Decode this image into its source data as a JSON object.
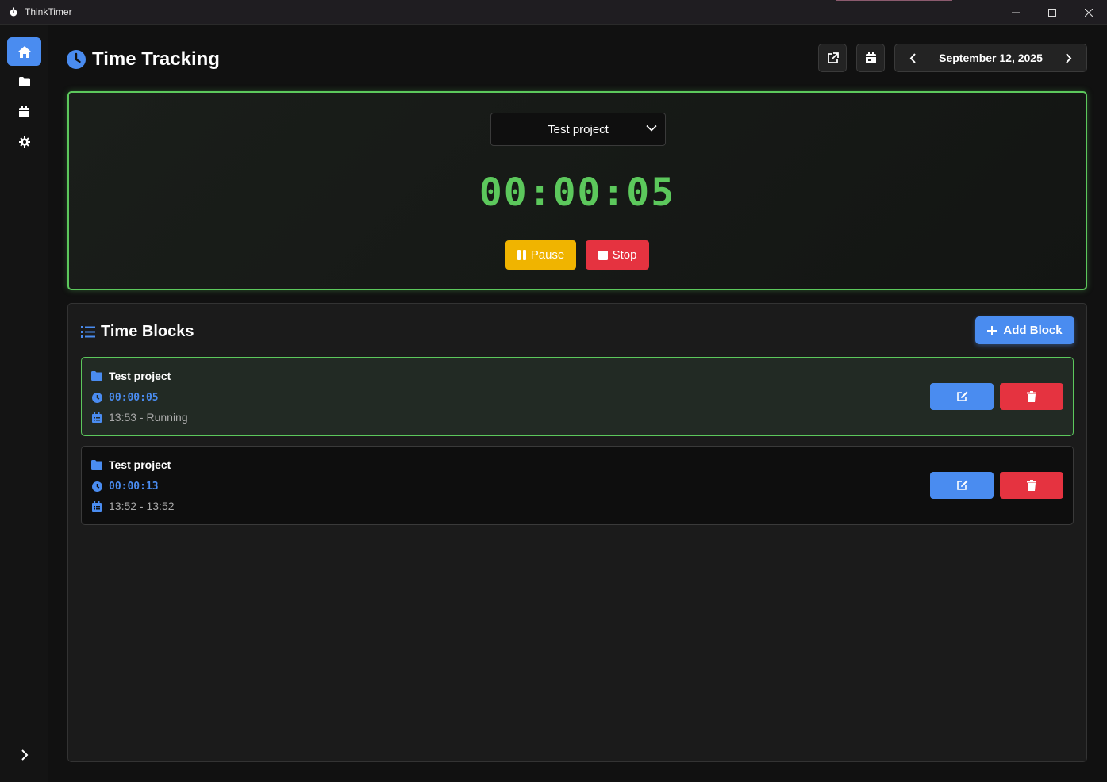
{
  "window": {
    "title": "ThinkTimer"
  },
  "sidebar": {
    "items": [
      {
        "name": "home",
        "icon": "home-icon",
        "active": true
      },
      {
        "name": "projects",
        "icon": "folder-icon",
        "active": false
      },
      {
        "name": "calendar",
        "icon": "calendar-icon",
        "active": false
      },
      {
        "name": "settings",
        "icon": "gear-icon",
        "active": false
      }
    ],
    "expand_icon": "chevron-right-icon"
  },
  "header": {
    "title": "Time Tracking",
    "date": "September 12, 2025"
  },
  "timer": {
    "project": "Test project",
    "elapsed": "00:00:05",
    "pause_label": "Pause",
    "stop_label": "Stop"
  },
  "blocks": {
    "title": "Time Blocks",
    "add_label": "Add Block",
    "items": [
      {
        "project": "Test project",
        "duration": "00:00:05",
        "range": "13:53 - Running",
        "running": true
      },
      {
        "project": "Test project",
        "duration": "00:00:13",
        "range": "13:52 - 13:52",
        "running": false
      }
    ]
  },
  "colors": {
    "accent": "#4a8cf0",
    "running": "#5cc85c",
    "pause": "#f0b400",
    "stop": "#e53340"
  }
}
